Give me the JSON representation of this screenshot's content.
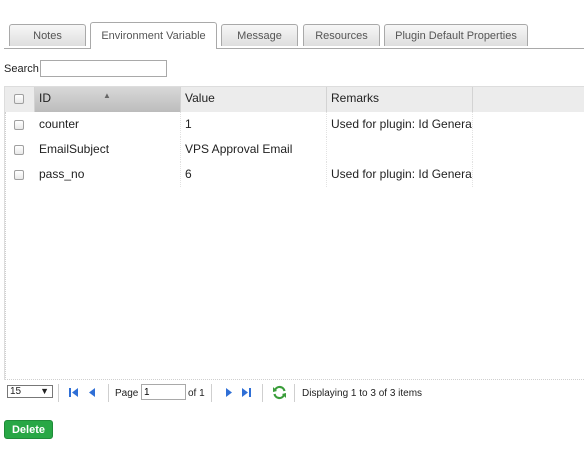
{
  "tabs": [
    {
      "label": "Notes"
    },
    {
      "label": "Environment Variable"
    },
    {
      "label": "Message"
    },
    {
      "label": "Resources"
    },
    {
      "label": "Plugin Default Properties"
    }
  ],
  "active_tab": "Environment Variable",
  "search": {
    "label": "Search",
    "value": "",
    "placeholder": ""
  },
  "grid": {
    "columns": [
      "ID",
      "Value",
      "Remarks"
    ],
    "sorted_column": "ID",
    "rows": [
      {
        "id": "counter",
        "value": "1",
        "remarks": "Used for plugin: Id Generator"
      },
      {
        "id": "EmailSubject",
        "value": "VPS Approval Email",
        "remarks": ""
      },
      {
        "id": "pass_no",
        "value": "6",
        "remarks": "Used for plugin: Id Generator"
      }
    ]
  },
  "pager": {
    "page_size": "15",
    "page_label": "Page",
    "page_value": "1",
    "of_label": "of 1",
    "display_message": "Displaying 1 to 3 of 3 items"
  },
  "actions": {
    "delete_label": "Delete"
  },
  "colors": {
    "accent_green": "#28a745",
    "nav_blue": "#2f6fd6",
    "refresh_green": "#3a9d3a"
  },
  "icons": [
    "first-page-icon",
    "prev-page-icon",
    "next-page-icon",
    "last-page-icon",
    "refresh-icon",
    "dropdown-arrow-icon"
  ]
}
